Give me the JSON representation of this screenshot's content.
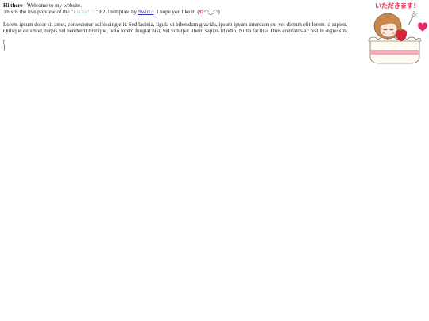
{
  "greeting": {
    "bold": "Hi there",
    "rest": " : Welcome to my website."
  },
  "preview": {
    "prefix": "This is the live preview of the \"",
    "template_name": "Lucky! ♡",
    "middle": "\" F2U template by ",
    "author": "Swirl",
    "note": "♫",
    "suffix": ". I hope you like it. (",
    "kaomoji_mark": "✿",
    "kaomoji_face": "◠‿◠",
    "end": ")"
  },
  "body_text": "Lorem ipsum dolor sit amet, consectetur adipiscing elit. Sed lacinia, ligula ut bibendum gravida, ipsum ipsum interdum ex, vel dictum elit lorem id sapien. Quisque euismod, turpis vel hendrerit tristique, odio lorem feugiat nisi, vel volutpat libero sapien id odio. Nulla facilisi. Duis convallis ac nisl in dignissim.",
  "brackets": {
    "open": "[",
    "close": "]"
  },
  "decoration": {
    "banner_text": "いただきます！",
    "colors": {
      "banner": "#e0355a",
      "hair": "#c9874e",
      "cream": "#fffaf2",
      "strawberry": "#d8283c",
      "sponge_stripe": "#f4a9b8",
      "heart": "#e8246a",
      "outline": "#6b4a3a"
    }
  }
}
